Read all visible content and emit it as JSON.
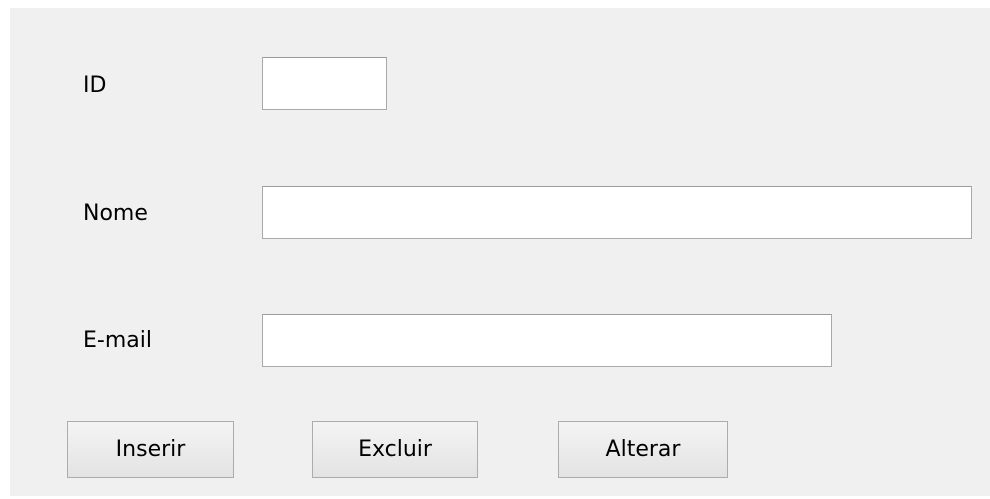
{
  "form": {
    "id_label": "ID",
    "id_value": "",
    "nome_label": "Nome",
    "nome_value": "",
    "email_label": "E-mail",
    "email_value": ""
  },
  "buttons": {
    "inserir": "Inserir",
    "excluir": "Excluir",
    "alterar": "Alterar"
  }
}
